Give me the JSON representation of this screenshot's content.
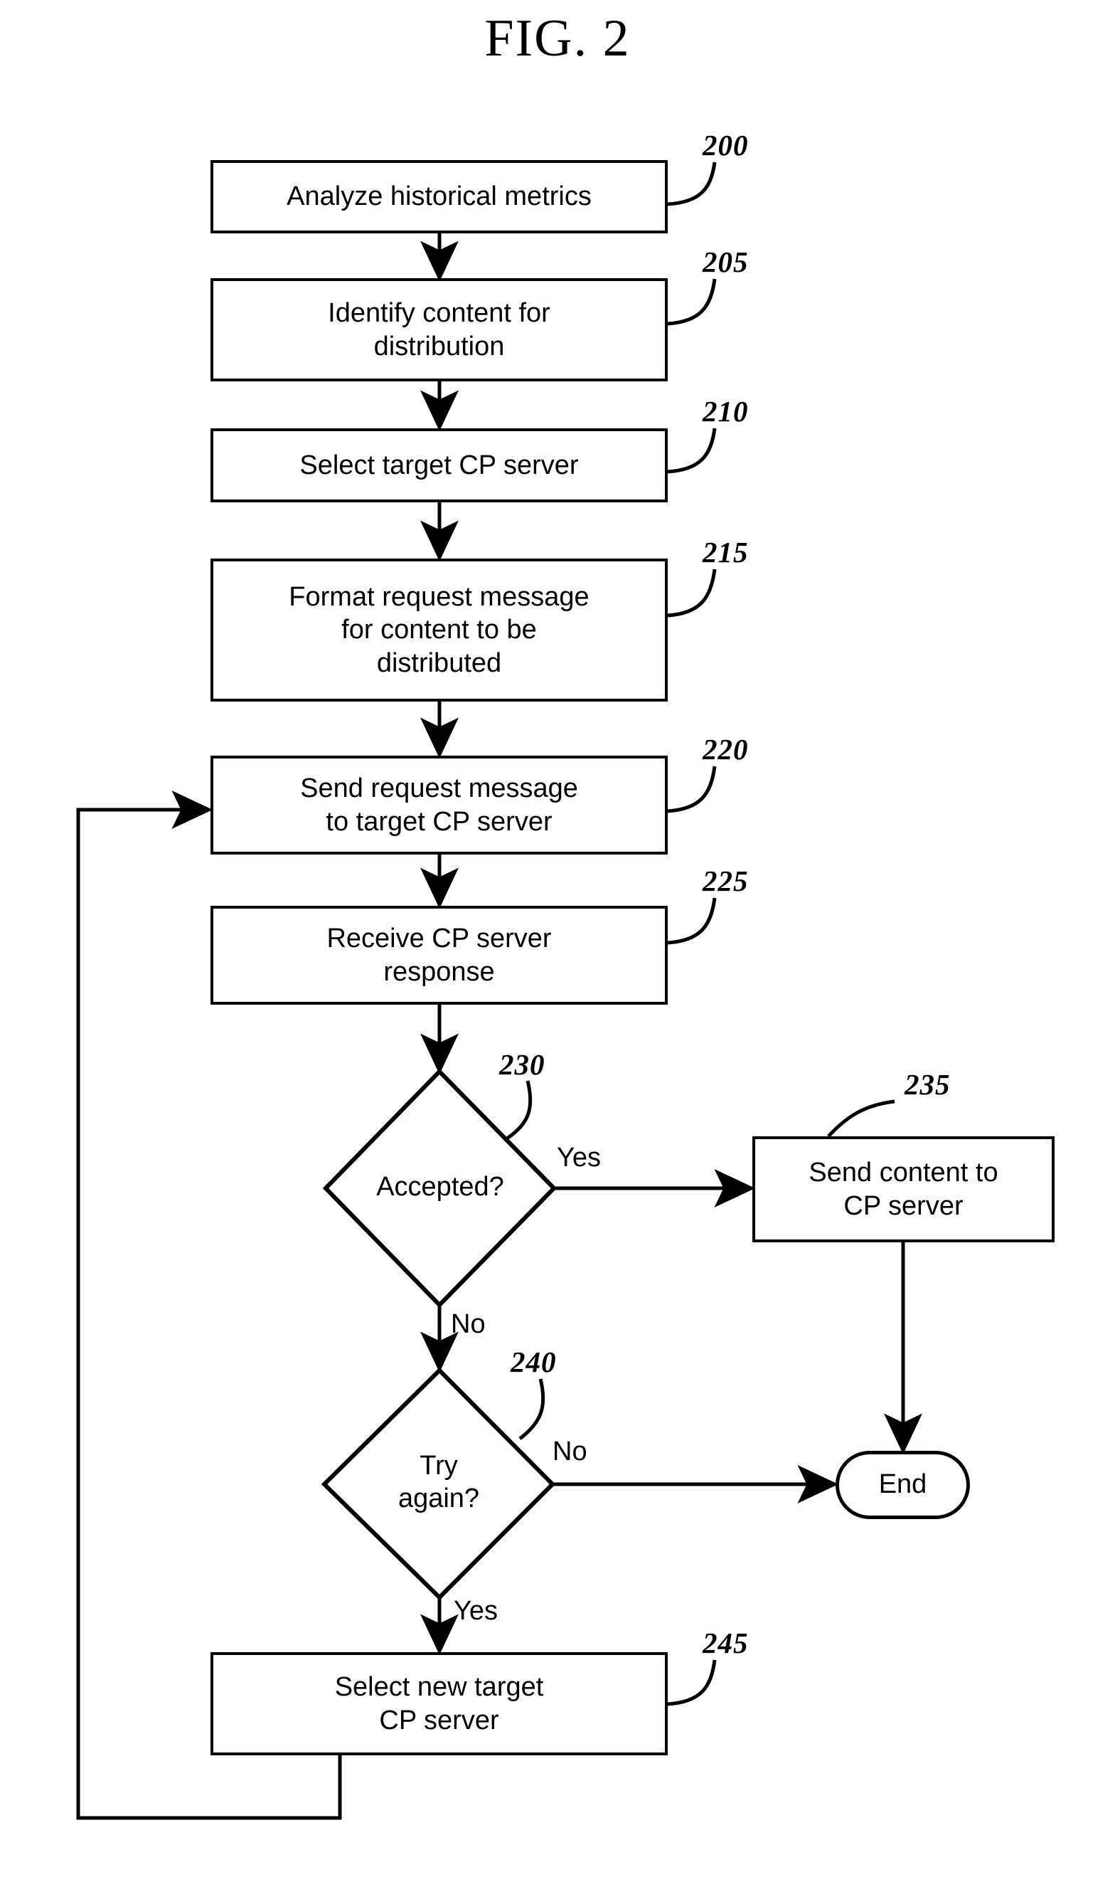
{
  "figure": {
    "title": "FIG. 2",
    "type": "patent-flowchart"
  },
  "nodes": {
    "n200": {
      "ref": "200",
      "text": "Analyze historical metrics",
      "shape": "process"
    },
    "n205": {
      "ref": "205",
      "line1": "Identify content for",
      "line2": "distribution",
      "shape": "process"
    },
    "n210": {
      "ref": "210",
      "text": "Select target CP server",
      "shape": "process"
    },
    "n215": {
      "ref": "215",
      "line1": "Format request message",
      "line2": "for content to be",
      "line3": "distributed",
      "shape": "process"
    },
    "n220": {
      "ref": "220",
      "line1": "Send request message",
      "line2": "to target CP server",
      "shape": "process"
    },
    "n225": {
      "ref": "225",
      "line1": "Receive CP server",
      "line2": "response",
      "shape": "process"
    },
    "n230": {
      "ref": "230",
      "text": "Accepted?",
      "shape": "decision"
    },
    "n235": {
      "ref": "235",
      "line1": "Send content to",
      "line2": "CP server",
      "shape": "process"
    },
    "n240": {
      "ref": "240",
      "line1": "Try",
      "line2": "again?",
      "shape": "decision"
    },
    "n245": {
      "ref": "245",
      "line1": "Select new target",
      "line2": "CP server",
      "shape": "process"
    },
    "nEnd": {
      "text": "End",
      "shape": "terminator"
    }
  },
  "branch_labels": {
    "accepted_yes": "Yes",
    "accepted_no": "No",
    "tryagain_no": "No",
    "tryagain_yes": "Yes"
  },
  "colors": {
    "ink": "#000000",
    "paper": "#ffffff"
  }
}
